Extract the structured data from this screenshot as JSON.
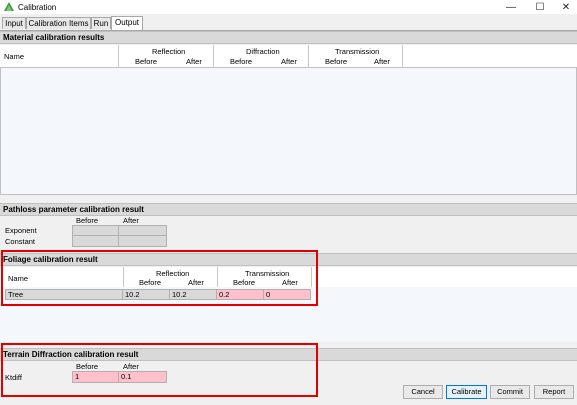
{
  "window": {
    "title": "Calibration",
    "min": "—",
    "max": "☐",
    "close": "✕"
  },
  "tabs": [
    "Input",
    "Calibration Items",
    "Run",
    "Output"
  ],
  "material": {
    "title": "Material calibration results",
    "name_col": "Name",
    "groups": [
      "Reflection",
      "Diffraction",
      "Transmission"
    ],
    "before": "Before",
    "after": "After"
  },
  "pathloss": {
    "title": "Pathloss parameter calibration result",
    "before": "Before",
    "after": "After",
    "rows": [
      "Exponent",
      "Constant"
    ]
  },
  "foliage": {
    "title": "Foliage calibration result",
    "name_col": "Name",
    "groups": [
      "Reflection",
      "Transmission"
    ],
    "before": "Before",
    "after": "After",
    "row": {
      "name": "Tree",
      "refl_before": "10.2",
      "refl_after": "10.2",
      "trans_before": "0.2",
      "trans_after": "0"
    }
  },
  "terrain": {
    "title": "Terrain Diffraction calibration result",
    "before": "Before",
    "after": "After",
    "row": {
      "name": "Ktdiff",
      "before": "1",
      "after": "0.1"
    }
  },
  "buttons": {
    "cancel": "Cancel",
    "calibrate": "Calibrate",
    "commit": "Commit",
    "report": "Report"
  }
}
